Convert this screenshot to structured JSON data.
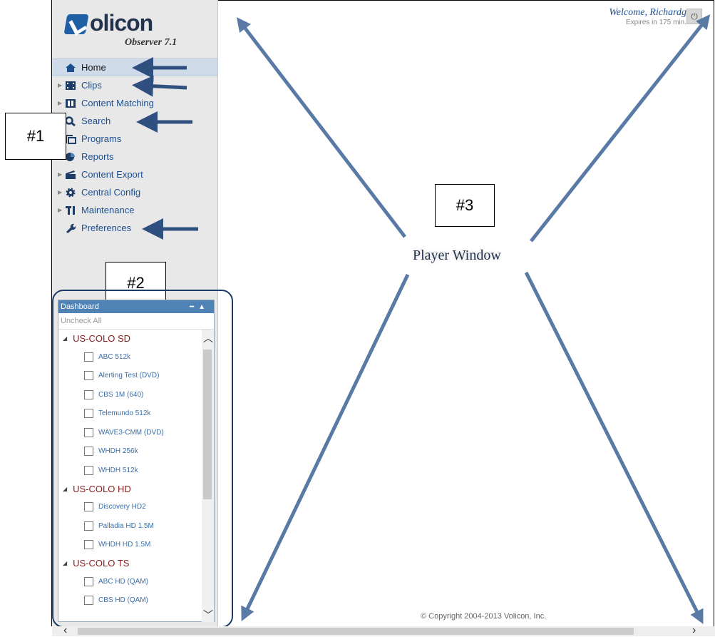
{
  "app": {
    "logo_text": "olicon",
    "logo_sub": "Observer 7.1"
  },
  "nav": {
    "items": [
      {
        "label": "Home",
        "icon": "home-icon",
        "active": true
      },
      {
        "label": "Clips",
        "icon": "film-icon"
      },
      {
        "label": "Content Matching",
        "icon": "content-matching-icon"
      },
      {
        "label": "Search",
        "icon": "search-icon"
      },
      {
        "label": "Programs",
        "icon": "programs-icon"
      },
      {
        "label": "Reports",
        "icon": "pie-chart-icon"
      },
      {
        "label": "Content Export",
        "icon": "clapper-icon"
      },
      {
        "label": "Central Config",
        "icon": "gear-icon"
      },
      {
        "label": "Maintenance",
        "icon": "tools-icon"
      },
      {
        "label": "Preferences",
        "icon": "wrench-icon"
      }
    ]
  },
  "annotations": {
    "a1": "#1",
    "a2": "#2",
    "a3": "#3"
  },
  "dashboard": {
    "title": "Dashboard",
    "uncheck_all": "Uncheck All",
    "groups": [
      {
        "name": "US-COLO SD",
        "channels": [
          "ABC 512k",
          "Alerting Test (DVD)",
          "CBS 1M (640)",
          "Telemundo 512k",
          "WAVE3-CMM (DVD)",
          "WHDH 256k",
          "WHDH 512k"
        ]
      },
      {
        "name": "US-COLO HD",
        "channels": [
          "Discovery HD2",
          "Palladia HD 1.5M",
          "WHDH HD 1.5M"
        ]
      },
      {
        "name": "US-COLO TS",
        "channels": [
          "ABC HD (QAM)",
          "CBS HD (QAM)"
        ]
      }
    ]
  },
  "header": {
    "welcome": "Welcome, Richardg",
    "expires": "Expires in 175 min."
  },
  "player": {
    "label": "Player Window"
  },
  "footer": {
    "copyright": "© Copyright 2004-2013 Volicon, Inc."
  },
  "colors": {
    "accent": "#1d4f8f",
    "arrow": "#2f4f7f",
    "group_text": "#8b1a1a"
  }
}
